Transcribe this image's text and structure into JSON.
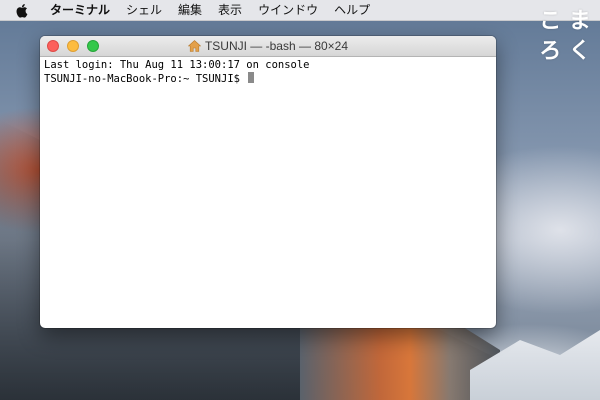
{
  "menubar": {
    "app_name": "ターミナル",
    "items": [
      "シェル",
      "編集",
      "表示",
      "ウインドウ",
      "ヘルプ"
    ]
  },
  "logo": {
    "chars": [
      "こ",
      "ま",
      "ろ",
      "く"
    ]
  },
  "terminal": {
    "title": "TSUNJI — -bash — 80×24",
    "lines": [
      "Last login: Thu Aug 11 13:00:17 on console",
      "TSUNJI-no-MacBook-Pro:~ TSUNJI$ "
    ]
  },
  "colors": {
    "close": "#fc605c",
    "minimize": "#fdbc40",
    "zoom": "#34c84a"
  },
  "icons": {
    "apple": "apple-icon",
    "title": "home-folder-icon"
  }
}
